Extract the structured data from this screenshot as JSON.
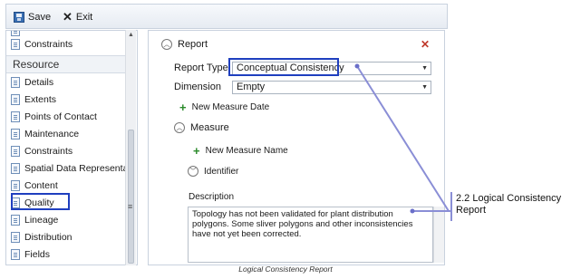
{
  "toolbar": {
    "save_label": "Save",
    "exit_label": "Exit"
  },
  "sidebar": {
    "top_item": "Constraints",
    "section_header": "Resource",
    "items": [
      "Details",
      "Extents",
      "Points of Contact",
      "Maintenance",
      "Constraints",
      "Spatial Data Representat",
      "Content",
      "Quality",
      "Lineage",
      "Distribution",
      "Fields"
    ],
    "selected_item": "Quality"
  },
  "report": {
    "title": "Report",
    "report_type_label": "Report Type",
    "report_type_value": "Conceptual Consistency",
    "dimension_label": "Dimension",
    "dimension_value": "Empty",
    "new_measure_date": "New Measure Date",
    "measure_label": "Measure",
    "new_measure_name": "New Measure Name",
    "identifier_label": "Identifier",
    "description_label": "Description",
    "description_text": "Topology has not been validated for plant distribution polygons. Some sliver polygons and other inconsistencies have not yet been corrected."
  },
  "annotation": {
    "callout": "2.2 Logical Consistency Report",
    "line_color": "#8a8ed6",
    "highlight_color": "#1f3fbf"
  },
  "caption": "Logical Consistency Report"
}
